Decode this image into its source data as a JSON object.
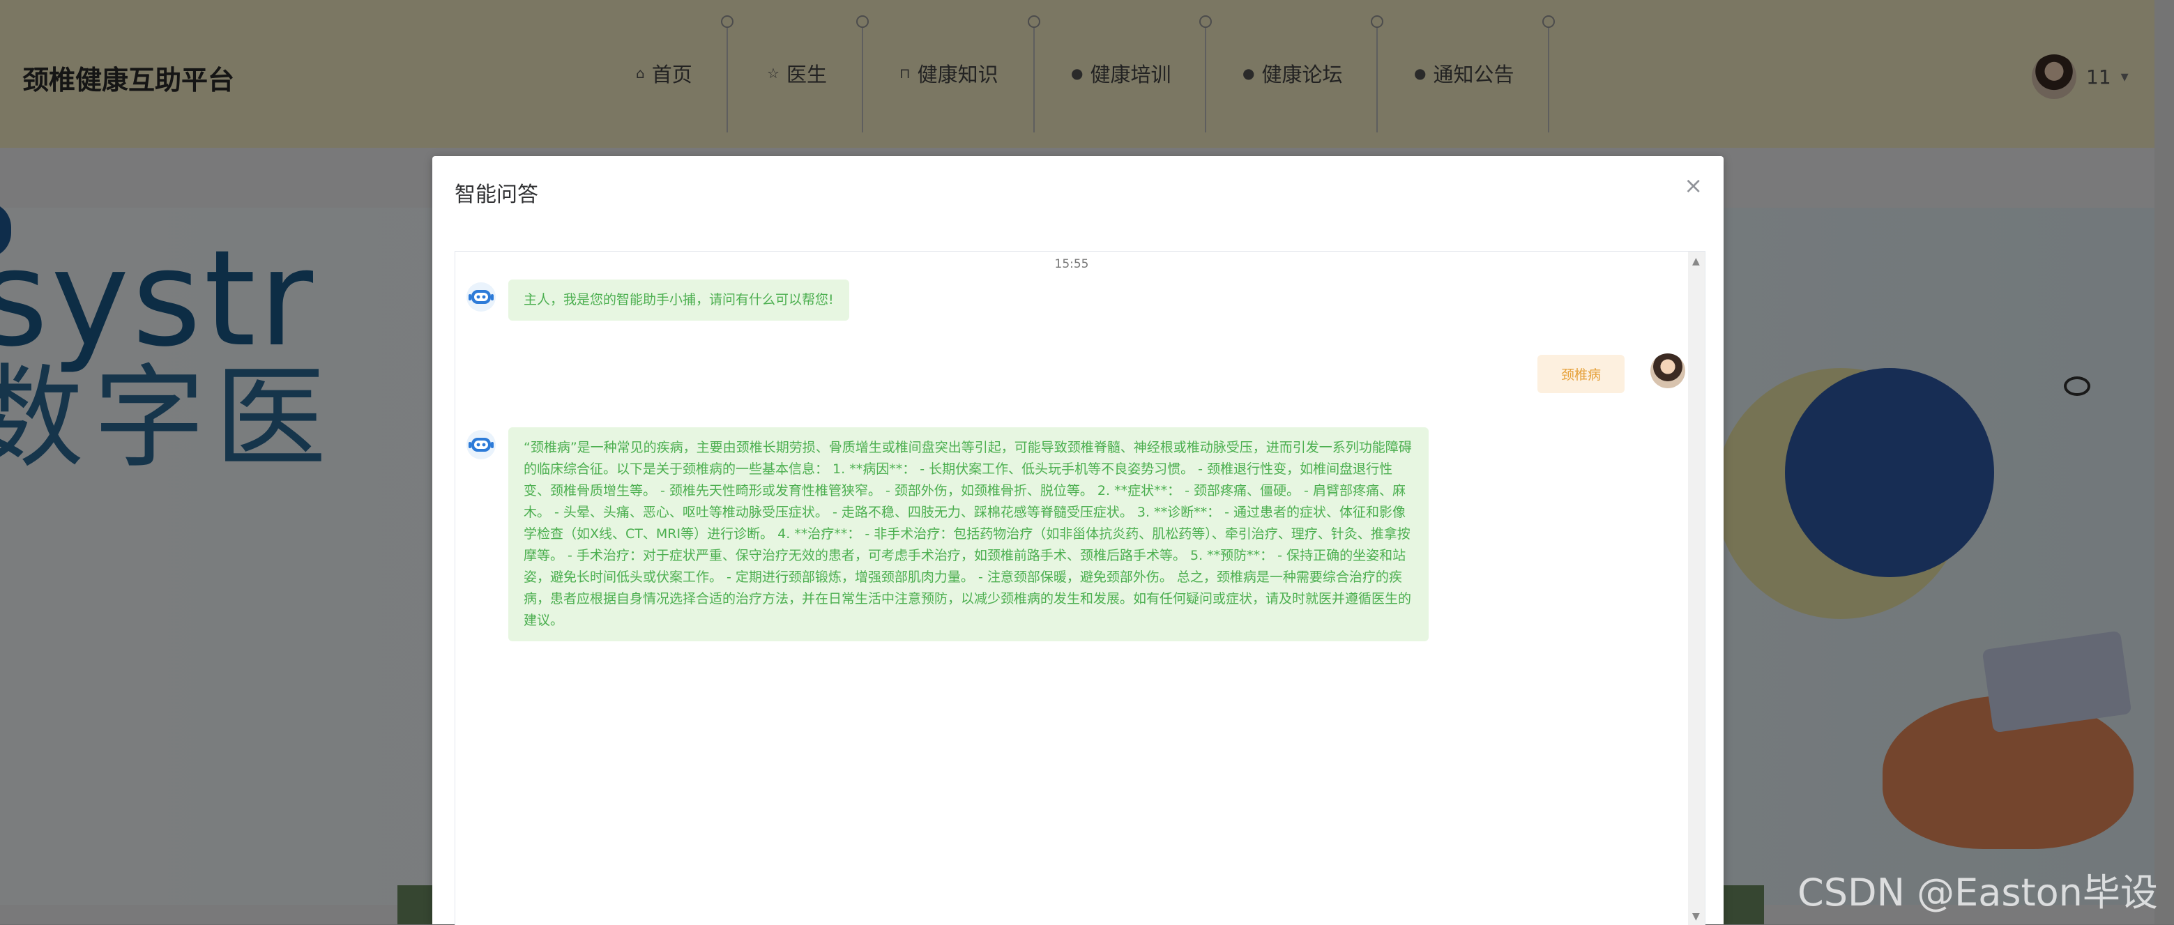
{
  "header": {
    "brand": "颈椎健康互助平台",
    "nav": [
      {
        "label": "首页",
        "icon": "home-icon",
        "glyph": "⌂"
      },
      {
        "label": "医生",
        "icon": "star-icon",
        "glyph": "☆"
      },
      {
        "label": "健康知识",
        "icon": "lock-icon",
        "glyph": "⊓"
      },
      {
        "label": "健康培训",
        "icon": "info-icon",
        "glyph": "●"
      },
      {
        "label": "健康论坛",
        "icon": "question-icon",
        "glyph": "●"
      },
      {
        "label": "通知公告",
        "icon": "info-icon",
        "glyph": "●"
      }
    ],
    "user_name": "11",
    "user_caret": "▾"
  },
  "hero": {
    "text_line1": "systr",
    "text_line2": "数字医"
  },
  "modal": {
    "title": "智能问答",
    "close_glyph": "×",
    "timestamp": "15:55",
    "messages": {
      "greeting": "主人，我是您的智能助手小捕，请问有什么可以帮您!",
      "user_question": "颈椎病",
      "answer": "“颈椎病”是一种常见的疾病，主要由颈椎长期劳损、骨质增生或椎间盘突出等引起，可能导致颈椎脊髓、神经根或椎动脉受压，进而引发一系列功能障碍的临床综合征。以下是关于颈椎病的一些基本信息： 1. **病因**： - 长期伏案工作、低头玩手机等不良姿势习惯。 - 颈椎退行性变，如椎间盘退行性变、颈椎骨质增生等。 - 颈椎先天性畸形或发育性椎管狭窄。 - 颈部外伤，如颈椎骨折、脱位等。 2. **症状**： - 颈部疼痛、僵硬。 - 肩臂部疼痛、麻木。 - 头晕、头痛、恶心、呕吐等椎动脉受压症状。 - 走路不稳、四肢无力、踩棉花感等脊髓受压症状。 3. **诊断**： - 通过患者的症状、体征和影像学检查（如X线、CT、MRI等）进行诊断。 4. **治疗**： - 非手术治疗：包括药物治疗（如非甾体抗炎药、肌松药等）、牵引治疗、理疗、针灸、推拿按摩等。 - 手术治疗：对于症状严重、保守治疗无效的患者，可考虑手术治疗，如颈椎前路手术、颈椎后路手术等。 5. **预防**： - 保持正确的坐姿和站姿，避免长时间低头或伏案工作。 - 定期进行颈部锻炼，增强颈部肌肉力量。 - 注意颈部保暖，避免颈部外伤。 总之，颈椎病是一种需要综合治疗的疾病，患者应根据自身情况选择合适的治疗方法，并在日常生活中注意预防，以减少颈椎病的发生和发展。如有任何疑问或症状，请及时就医并遵循医生的建议。"
    }
  },
  "watermark": "CSDN @Easton毕设",
  "colors": {
    "bot_bubble_bg": "#e7f6e1",
    "bot_text": "#4caf50",
    "user_bubble_bg": "#fdf0df",
    "user_text": "#e6a23c"
  }
}
